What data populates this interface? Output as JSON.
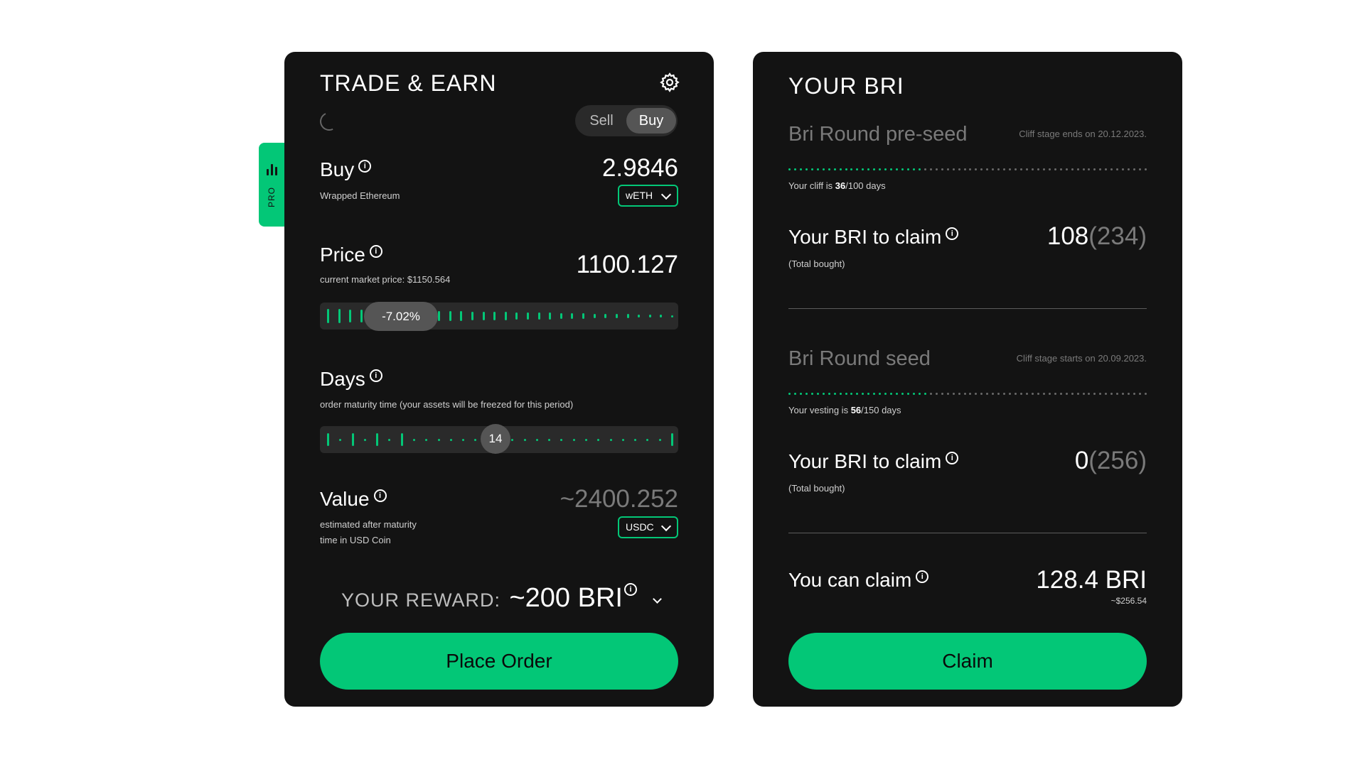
{
  "trade": {
    "title": "TRADE & EARN",
    "toggle": {
      "sell": "Sell",
      "buy": "Buy",
      "selected": "Buy"
    },
    "buy": {
      "label": "Buy",
      "sub": "Wrapped Ethereum",
      "amount": "2.9846",
      "token": "wETH"
    },
    "price": {
      "label": "Price",
      "sub": "current market price: $1150.564",
      "amount": "1100.127",
      "slider_label": "-7.02%",
      "slider_level": 0.16
    },
    "days": {
      "label": "Days",
      "sub": "order maturity time (your assets will be freezed for this period)",
      "value": "14",
      "slider_level": 0.48
    },
    "value": {
      "label": "Value",
      "sub_line1": "estimated after maturity",
      "sub_line2": "time in USD Coin",
      "amount": "~2400.252",
      "token": "USDC"
    },
    "reward": {
      "label": "YOUR REWARD:",
      "amount": "~200 BRI"
    },
    "place_order": "Place Order",
    "pro_tab": "PRO"
  },
  "bri": {
    "title": "YOUR BRI",
    "rounds": [
      {
        "name": "Bri Round pre-seed",
        "stage": "Cliff stage ends on 20.12.2023.",
        "progress_prefix": "Your cliff is ",
        "progress_value": "36",
        "progress_suffix": "/100 days",
        "progress_fraction": 0.36,
        "claim_label": "Your BRI to claim",
        "claim_sub": "(Total bought)",
        "claim_amount": "108",
        "claim_total": "(234)"
      },
      {
        "name": "Bri Round seed",
        "stage": "Cliff stage starts on 20.09.2023.",
        "progress_prefix": "Your vesting is ",
        "progress_value": "56",
        "progress_suffix": "/150 days",
        "progress_fraction": 0.373,
        "claim_label": "Your BRI to claim",
        "claim_sub": "(Total bought)",
        "claim_amount": "0",
        "claim_total": "(256)"
      }
    ],
    "you_can_claim": {
      "label": "You can claim",
      "amount": "128.4 BRI",
      "usd": "~$256.54"
    },
    "claim_button": "Claim"
  },
  "colors": {
    "accent": "#03c777",
    "card": "#131313",
    "muted": "#7a7a7a"
  }
}
